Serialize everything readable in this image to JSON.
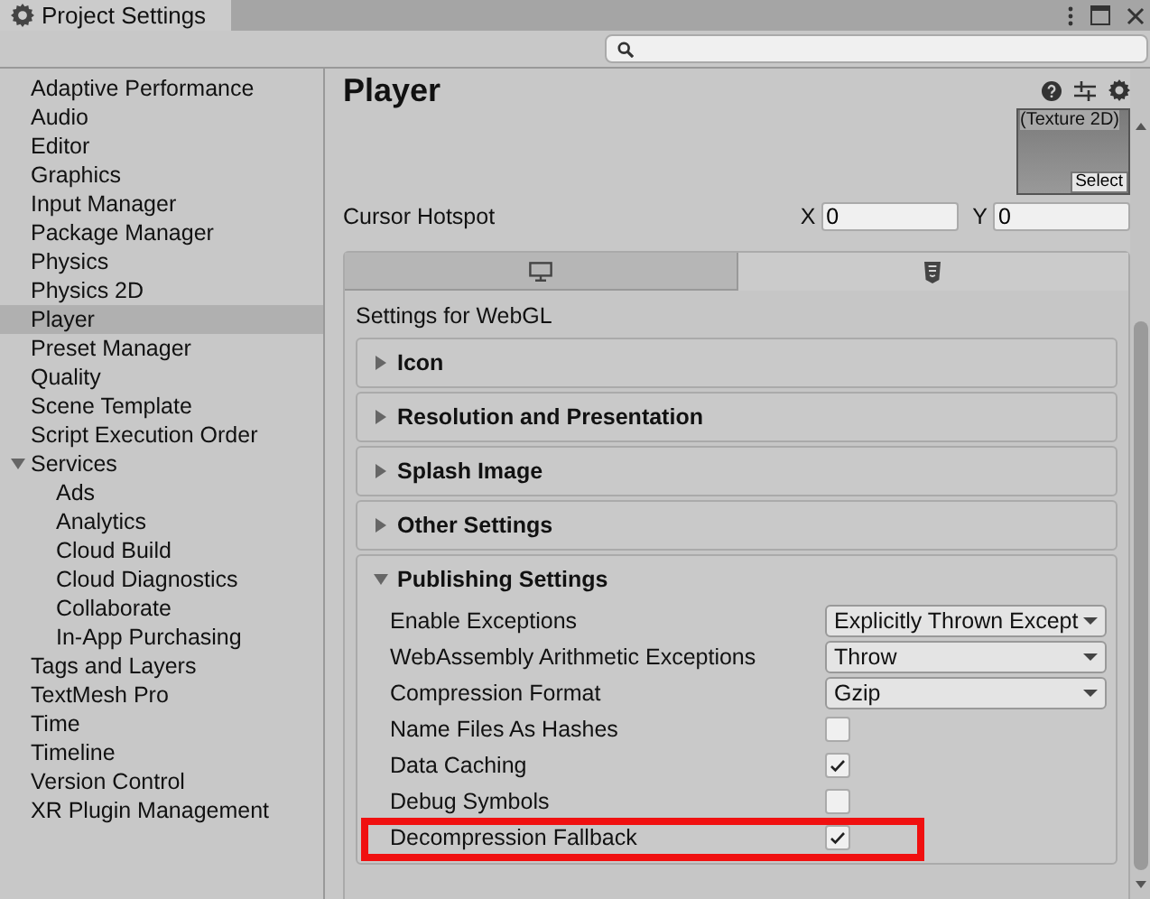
{
  "window": {
    "title": "Project Settings"
  },
  "sidebar": {
    "items": [
      {
        "label": "Adaptive Performance",
        "selected": false
      },
      {
        "label": "Audio",
        "selected": false
      },
      {
        "label": "Editor",
        "selected": false
      },
      {
        "label": "Graphics",
        "selected": false
      },
      {
        "label": "Input Manager",
        "selected": false
      },
      {
        "label": "Package Manager",
        "selected": false
      },
      {
        "label": "Physics",
        "selected": false
      },
      {
        "label": "Physics 2D",
        "selected": false
      },
      {
        "label": "Player",
        "selected": true
      },
      {
        "label": "Preset Manager",
        "selected": false
      },
      {
        "label": "Quality",
        "selected": false
      },
      {
        "label": "Scene Template",
        "selected": false
      },
      {
        "label": "Script Execution Order",
        "selected": false
      },
      {
        "label": "Services",
        "selected": false,
        "expanded": true,
        "children": [
          {
            "label": "Ads",
            "selected": false
          },
          {
            "label": "Analytics",
            "selected": false
          },
          {
            "label": "Cloud Build",
            "selected": false
          },
          {
            "label": "Cloud Diagnostics",
            "selected": false
          },
          {
            "label": "Collaborate",
            "selected": false
          },
          {
            "label": "In-App Purchasing",
            "selected": false
          }
        ]
      },
      {
        "label": "Tags and Layers",
        "selected": false
      },
      {
        "label": "TextMesh Pro",
        "selected": false
      },
      {
        "label": "Time",
        "selected": false
      },
      {
        "label": "Timeline",
        "selected": false
      },
      {
        "label": "Version Control",
        "selected": false
      },
      {
        "label": "XR Plugin Management",
        "selected": false
      }
    ]
  },
  "panel": {
    "title": "Player",
    "texture": {
      "label": "(Texture 2D)",
      "button": "Select"
    },
    "cursor_hotspot": {
      "label": "Cursor Hotspot",
      "x_label": "X",
      "x_value": "0",
      "y_label": "Y",
      "y_value": "0"
    },
    "platform_tabs": [
      {
        "kind": "desktop",
        "selected": false
      },
      {
        "kind": "html5",
        "selected": true
      }
    ],
    "settings_heading": "Settings for WebGL",
    "sections": [
      {
        "title": "Icon",
        "expanded": false
      },
      {
        "title": "Resolution and Presentation",
        "expanded": false
      },
      {
        "title": "Splash Image",
        "expanded": false
      },
      {
        "title": "Other Settings",
        "expanded": false
      },
      {
        "title": "Publishing Settings",
        "expanded": true,
        "fields": [
          {
            "kind": "dropdown",
            "label": "Enable Exceptions",
            "value": "Explicitly Thrown Except",
            "highlighted": false
          },
          {
            "kind": "dropdown",
            "label": "WebAssembly Arithmetic Exceptions",
            "value": "Throw",
            "highlighted": false
          },
          {
            "kind": "dropdown",
            "label": "Compression Format",
            "value": "Gzip",
            "highlighted": false
          },
          {
            "kind": "checkbox",
            "label": "Name Files As Hashes",
            "checked": false,
            "highlighted": false
          },
          {
            "kind": "checkbox",
            "label": "Data Caching",
            "checked": true,
            "highlighted": false
          },
          {
            "kind": "checkbox",
            "label": "Debug Symbols",
            "checked": false,
            "highlighted": false
          },
          {
            "kind": "checkbox",
            "label": "Decompression Fallback",
            "checked": true,
            "highlighted": true
          }
        ]
      }
    ]
  }
}
